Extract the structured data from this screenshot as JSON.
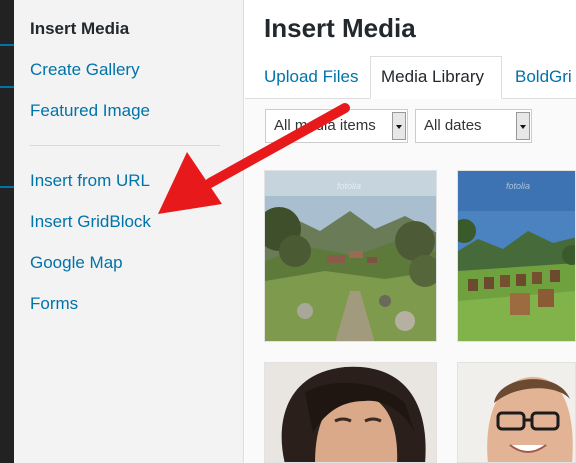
{
  "sidebar": {
    "active": "Insert Media",
    "items": [
      "Create Gallery",
      "Featured Image"
    ],
    "items2": [
      "Insert from URL",
      "Insert GridBlock",
      "Google Map",
      "Forms"
    ]
  },
  "main": {
    "title": "Insert Media",
    "tabs": [
      "Upload Files",
      "Media Library",
      "BoldGri"
    ],
    "filters": {
      "type": "All media items",
      "date": "All dates"
    },
    "watermark": "fotolia"
  },
  "annotation": {
    "arrow_color": "#e8191b"
  }
}
